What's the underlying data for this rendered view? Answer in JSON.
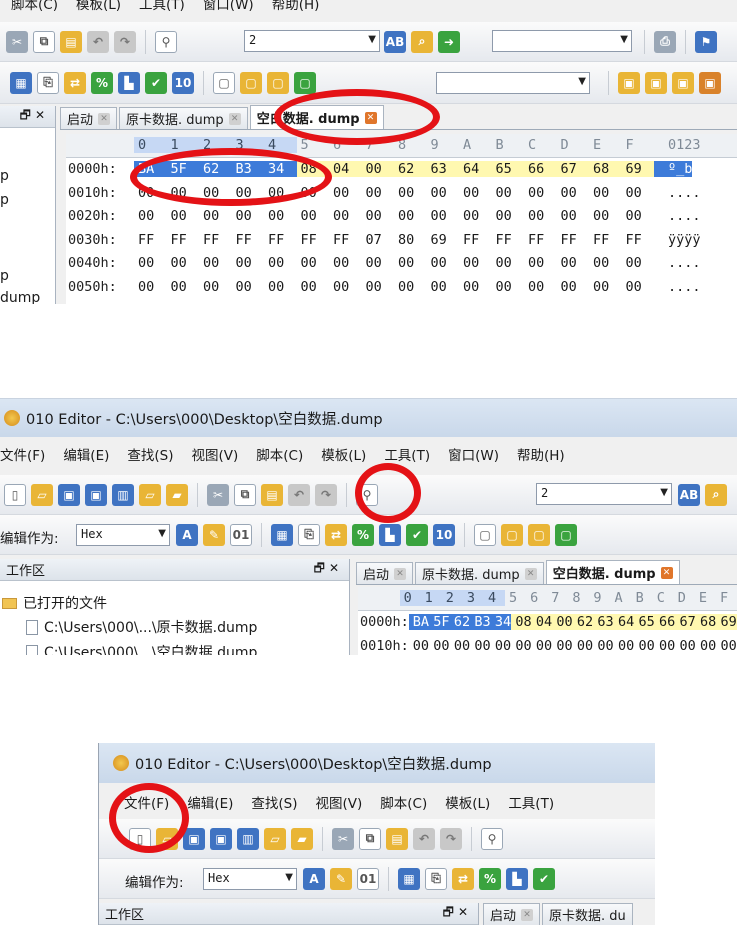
{
  "app": {
    "title": "010 Editor - C:\\Users\\000\\Desktop\\空白数据.dump"
  },
  "menu": {
    "file": "文件(F)",
    "edit": "编辑(E)",
    "find": "查找(S)",
    "view": "视图(V)",
    "script": "脚本(C)",
    "template": "模板(L)",
    "tools": "工具(T)",
    "window": "窗口(W)",
    "help": "帮助(H)"
  },
  "panel1_menu": {
    "script": "脚本(C)",
    "template": "模板(L)",
    "tools": "工具(T)",
    "window": "窗口(W)",
    "help": "帮助(H)"
  },
  "search": {
    "value": "2"
  },
  "edit_as": {
    "label": "编辑作为:",
    "value": "Hex"
  },
  "workspace": {
    "title": "工作区",
    "open_files": "已打开的文件",
    "files": [
      "C:\\Users\\000\\...\\原卡数据.dump",
      "C:\\Users\\000\\...\\空白数据.dump"
    ]
  },
  "panel1_sidebar_fragments": [
    "p",
    "p",
    "p",
    "dump"
  ],
  "tabs": {
    "start": "启动",
    "orig": "原卡数据. dump",
    "blank": "空白数据. dump",
    "orig_cut": "原卡数据. du"
  },
  "hex": {
    "ruler": [
      "0",
      "1",
      "2",
      "3",
      "4",
      "5",
      "6",
      "7",
      "8",
      "9",
      "A",
      "B",
      "C",
      "D",
      "E",
      "F"
    ],
    "ascii_header": "0123",
    "rows": [
      {
        "addr": "0000h:",
        "bytes": [
          "BA",
          "5F",
          "62",
          "B3",
          "34",
          "08",
          "04",
          "00",
          "62",
          "63",
          "64",
          "65",
          "66",
          "67",
          "68",
          "69"
        ],
        "ascii": "º_b"
      },
      {
        "addr": "0010h:",
        "bytes": [
          "00",
          "00",
          "00",
          "00",
          "00",
          "00",
          "00",
          "00",
          "00",
          "00",
          "00",
          "00",
          "00",
          "00",
          "00",
          "00"
        ],
        "ascii": "...."
      },
      {
        "addr": "0020h:",
        "bytes": [
          "00",
          "00",
          "00",
          "00",
          "00",
          "00",
          "00",
          "00",
          "00",
          "00",
          "00",
          "00",
          "00",
          "00",
          "00",
          "00"
        ],
        "ascii": "...."
      },
      {
        "addr": "0030h:",
        "bytes": [
          "FF",
          "FF",
          "FF",
          "FF",
          "FF",
          "FF",
          "FF",
          "07",
          "80",
          "69",
          "FF",
          "FF",
          "FF",
          "FF",
          "FF",
          "FF"
        ],
        "ascii": "ÿÿÿÿ"
      },
      {
        "addr": "0040h:",
        "bytes": [
          "00",
          "00",
          "00",
          "00",
          "00",
          "00",
          "00",
          "00",
          "00",
          "00",
          "00",
          "00",
          "00",
          "00",
          "00",
          "00"
        ],
        "ascii": "...."
      },
      {
        "addr": "0050h:",
        "bytes": [
          "00",
          "00",
          "00",
          "00",
          "00",
          "00",
          "00",
          "00",
          "00",
          "00",
          "00",
          "00",
          "00",
          "00",
          "00",
          "00"
        ],
        "ascii": "...."
      }
    ]
  },
  "colors": {
    "annotation": "#e41216",
    "selection": "#3d7bd9",
    "highlight": "#fff8b0"
  }
}
